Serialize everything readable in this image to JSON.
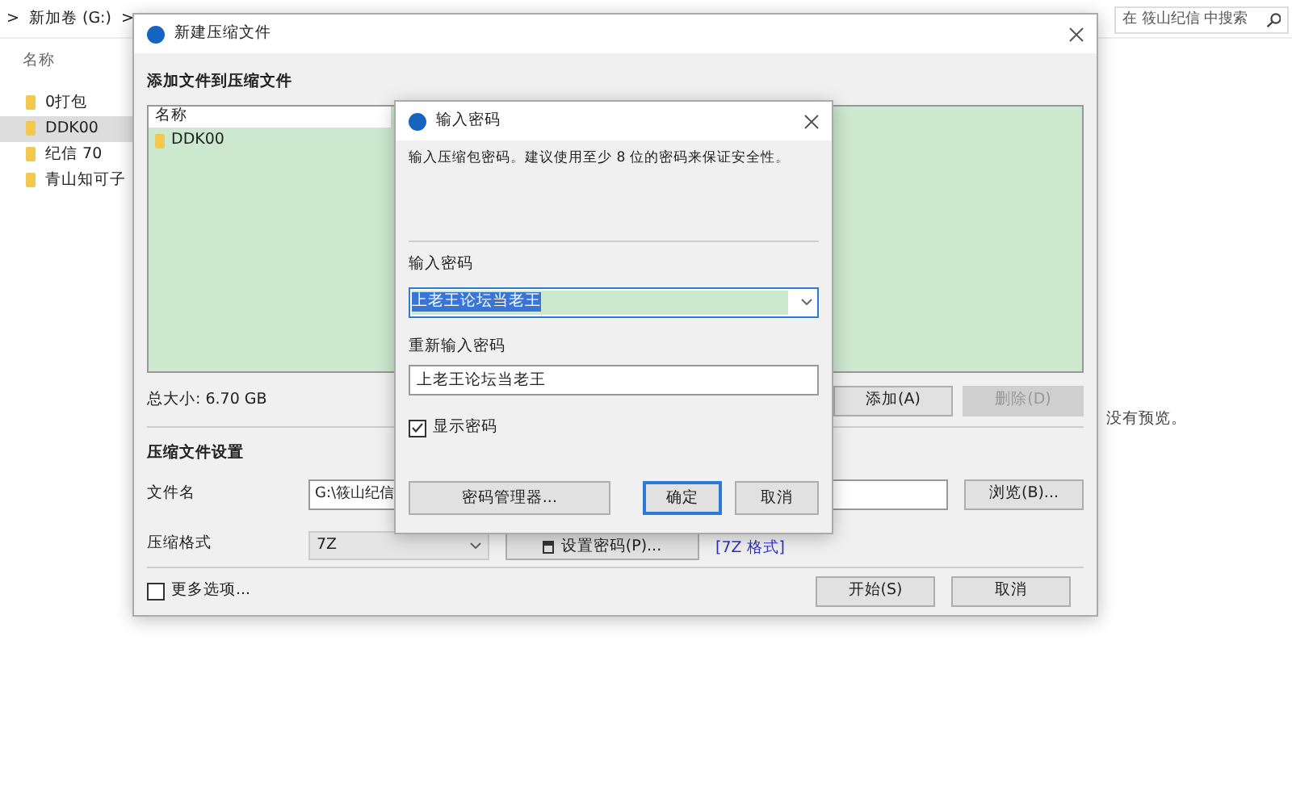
{
  "explorer": {
    "breadcrumb": [
      ">",
      "新加卷 (G:)",
      ">"
    ],
    "search": {
      "placeholder": "在 筱山纪信 中搜索"
    },
    "column_header": "名称",
    "items": [
      {
        "label": "0打包",
        "selected": false
      },
      {
        "label": "DDK00",
        "selected": true
      },
      {
        "label": "纪信 70",
        "selected": false
      },
      {
        "label": "青山知可子",
        "selected": false
      }
    ],
    "preview": "没有预览。"
  },
  "archive_dialog": {
    "title": "新建压缩文件",
    "section_files": "添加文件到压缩文件",
    "list_header": "名称",
    "files": [
      {
        "label": "DDK00"
      }
    ],
    "total_size": "总大小: 6.70 GB",
    "add_button": {
      "label": "添加(A)",
      "disabled": false
    },
    "delete_button": {
      "label": "删除(D)",
      "disabled": true
    },
    "section_settings": "压缩文件设置",
    "filename_label": "文件名",
    "filename_value": "G:\\筱山纪信",
    "browse_button": "浏览(B)...",
    "format_label": "压缩格式",
    "format_value": "7Z",
    "set_password_button": "设置密码(P)...",
    "format_link": "[7Z 格式]",
    "more_options": {
      "label": "更多选项...",
      "checked": false
    },
    "start_button": "开始(S)",
    "cancel_button": "取消"
  },
  "password_dialog": {
    "title": "输入密码",
    "description": "输入压缩包密码。建议使用至少 8 位的密码来保证安全性。",
    "password_label": "输入密码",
    "password": {
      "value": "上老王论坛当老王",
      "text_selected": true
    },
    "confirm_label": "重新输入密码",
    "confirm_value": "上老王论坛当老王",
    "show_password": {
      "label": "显示密码",
      "checked": true
    },
    "manager_button": "密码管理器...",
    "ok_button": {
      "label": "确定",
      "default": true
    },
    "cancel_button": {
      "label": "取消",
      "default": false
    }
  }
}
